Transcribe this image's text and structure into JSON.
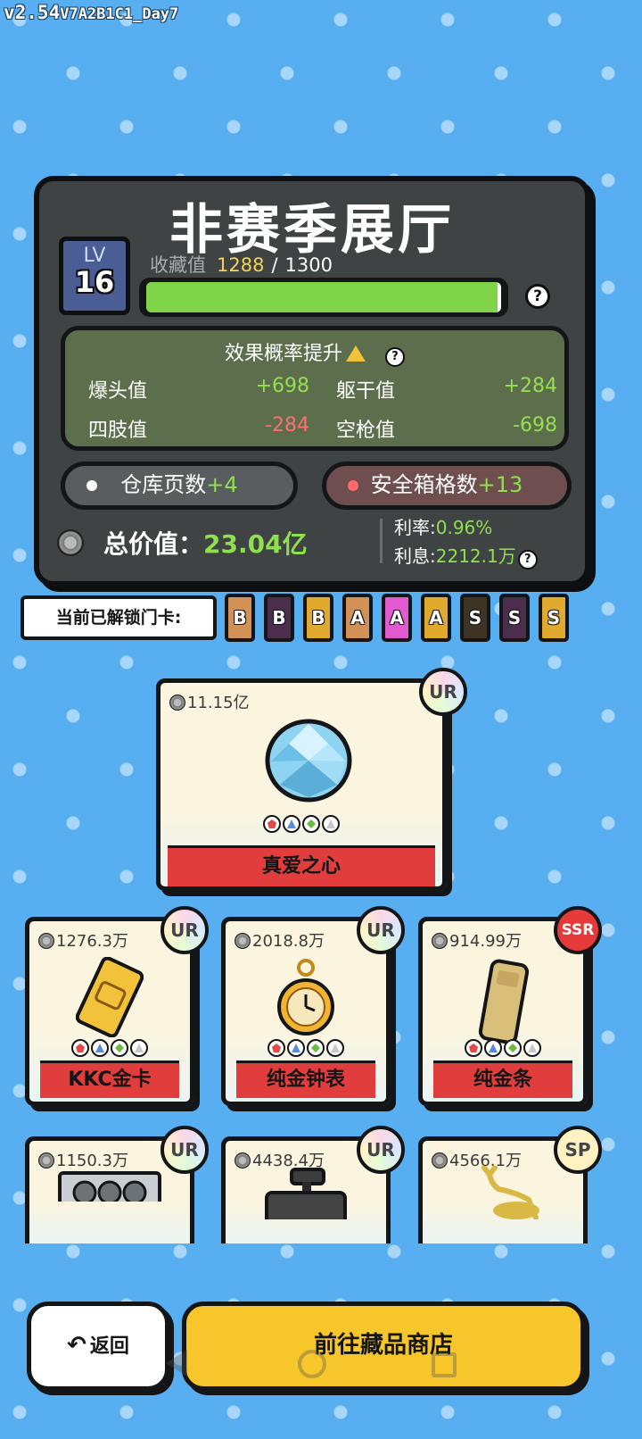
{
  "version": {
    "main": "v2.54",
    "build": "V7A2B1C1_Day7"
  },
  "hall": {
    "title": "非赛季展厅",
    "level_label": "LV",
    "level": "16",
    "collect_label": "收藏值",
    "collect_current": "1288",
    "collect_sep": "/",
    "collect_max": "1300",
    "collect_progress": 0.9908,
    "help_glyph": "?",
    "effect_title": "效果概率提升",
    "stats": [
      {
        "key": "爆头值",
        "value": "+698"
      },
      {
        "key": "躯干值",
        "value": "+284"
      },
      {
        "key": "四肢值",
        "value": "-284"
      },
      {
        "key": "空枪值",
        "value": "-698"
      }
    ],
    "storage_label": "仓库页数",
    "storage_plus": "+4",
    "safe_label": "安全箱格数",
    "safe_plus": "+13",
    "total_label": "总价值：",
    "total_value": "23.04亿",
    "rate_label": "利率:",
    "rate_value": "0.96%",
    "interest_label": "利息:",
    "interest_value": "2212.1万"
  },
  "unlocked": {
    "label": "当前已解锁门卡:",
    "cards": [
      {
        "letter": "B",
        "color": "#d29257"
      },
      {
        "letter": "B",
        "color": "#4a2e4b"
      },
      {
        "letter": "B",
        "color": "#dfaa2d"
      },
      {
        "letter": "A",
        "color": "#d29257"
      },
      {
        "letter": "A",
        "color": "#e05bd0"
      },
      {
        "letter": "A",
        "color": "#dfaa2d"
      },
      {
        "letter": "S",
        "color": "#3e3424"
      },
      {
        "letter": "S",
        "color": "#4a2e4b"
      },
      {
        "letter": "S",
        "color": "#dfaa2d"
      }
    ]
  },
  "featured": {
    "price": "11.15亿",
    "rarity": "UR",
    "name": "真爱之心",
    "icon": "diamond-icon"
  },
  "items": [
    {
      "price": "1276.3万",
      "rarity": "UR",
      "name": "KKC金卡",
      "icon": "gold-card-icon"
    },
    {
      "price": "2018.8万",
      "rarity": "UR",
      "name": "纯金钟表",
      "icon": "pocket-watch-icon"
    },
    {
      "price": "914.99万",
      "rarity": "SSR",
      "name": "纯金条",
      "icon": "gold-bar-icon"
    },
    {
      "price": "1150.3万",
      "rarity": "UR",
      "name": "",
      "icon": "graphics-card-icon"
    },
    {
      "price": "4438.4万",
      "rarity": "UR",
      "name": "",
      "icon": "camera-icon"
    },
    {
      "price": "4566.1万",
      "rarity": "SP",
      "name": "",
      "icon": "golden-deer-icon"
    }
  ],
  "buttons": {
    "back": "返回",
    "shop": "前往藏品商店"
  },
  "colors": {
    "background": "#57aef0",
    "accent_green": "#8ee04e",
    "negative_red": "#ff6e6e",
    "shop_yellow": "#f6c62b"
  }
}
